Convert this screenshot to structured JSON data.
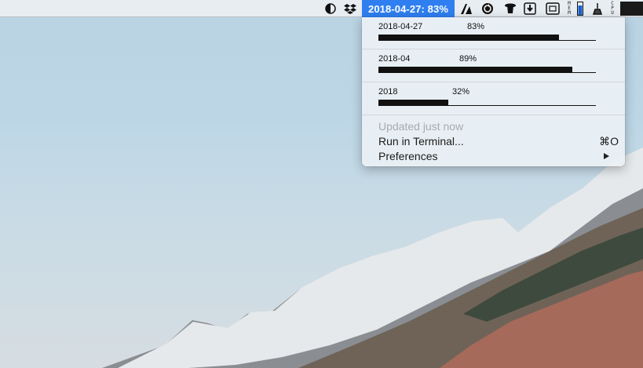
{
  "menubar": {
    "status_item_label": "2018-04-27: 83%",
    "icons": [
      "contrast-icon",
      "dropbox-icon",
      "cobook-icon",
      "sync-icon",
      "top-hat-icon",
      "download-icon",
      "screenshot-icon",
      "battery-icon",
      "cleaner-icon",
      "cpu-meter-icon"
    ],
    "mem_label": "MEM",
    "cpu_label": "CPU"
  },
  "menu": {
    "periods": [
      {
        "label": "2018-04-27",
        "percent_text": "83%",
        "progress": 0.83
      },
      {
        "label": "2018-04",
        "percent_text": "89%",
        "progress": 0.89
      },
      {
        "label": "2018",
        "percent_text": "32%",
        "progress": 0.32
      }
    ],
    "updated_label": "Updated just now",
    "run_terminal_label": "Run in Terminal...",
    "run_terminal_shortcut": "⌘O",
    "preferences_label": "Preferences"
  },
  "colors": {
    "accent": "#2f7ff0",
    "bar": "#111111",
    "menu_background": "#e9eff4"
  }
}
